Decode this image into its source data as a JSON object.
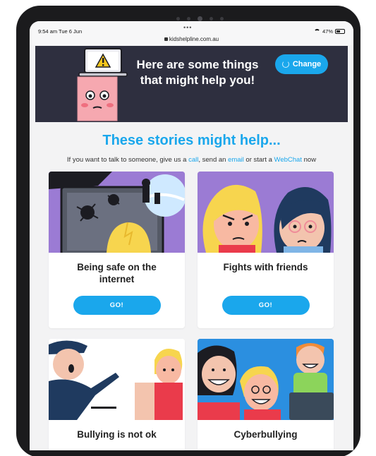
{
  "status_bar": {
    "time": "9:54 am  Tue 6 Jun",
    "dots": "•••",
    "url": "kidshelpline.com.au",
    "battery": "47%"
  },
  "hero": {
    "title": "Here are some things that might help you!",
    "change_label": "Change",
    "icons": [
      "laptop-warning-icon",
      "sad-face-character",
      "refresh-icon"
    ]
  },
  "intro": {
    "title": "These stories might help...",
    "sub_prefix": "If you want to talk to someone, give us a ",
    "link_call": "call",
    "sub_mid1": ", send an ",
    "link_email": "email",
    "sub_mid2": " or start a ",
    "link_webchat": "WebChat",
    "sub_suffix": " now"
  },
  "cards": [
    {
      "title": "Being safe on the internet",
      "button": "GO!"
    },
    {
      "title": "Fights with friends",
      "button": "GO!"
    },
    {
      "title": "Bullying is not ok"
    },
    {
      "title": "Cyberbullying"
    }
  ],
  "colors": {
    "accent": "#1aa7ec",
    "hero_bg": "#2e2f3f",
    "card_purple": "#9b7bd4",
    "card_blue": "#2b8fe0"
  }
}
